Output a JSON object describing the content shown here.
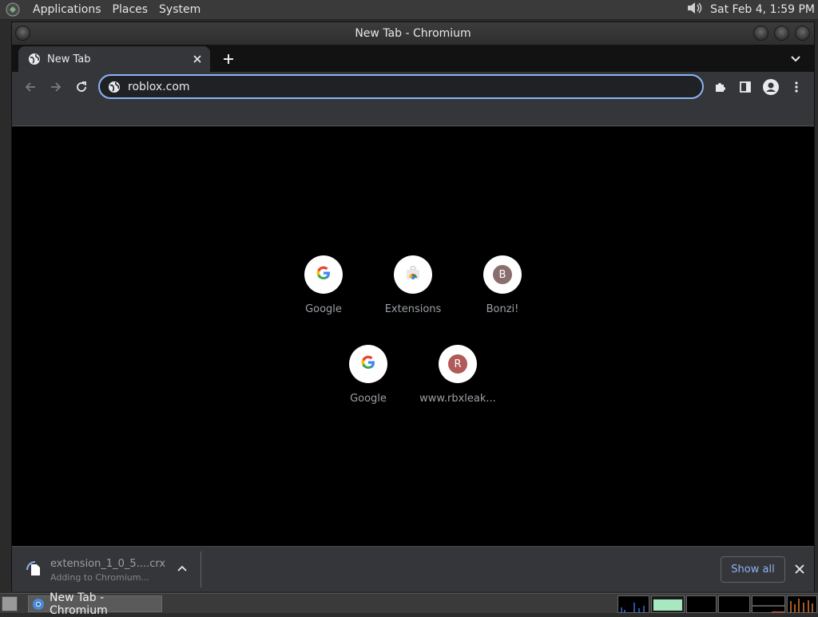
{
  "top_panel": {
    "menus": [
      "Applications",
      "Places",
      "System"
    ],
    "clock": "Sat Feb  4,  1:59 PM"
  },
  "window": {
    "title": "New Tab - Chromium"
  },
  "tab": {
    "title": "New Tab"
  },
  "omnibox": {
    "value": "roblox.com"
  },
  "shortcuts": [
    {
      "label": "Google",
      "icon": "google-g-icon"
    },
    {
      "label": "Extensions",
      "icon": "chrome-web-store-icon"
    },
    {
      "label": "Bonzi!",
      "letter": "B",
      "color": "#8a6d6d"
    },
    {
      "label": "Google",
      "icon": "google-g-icon"
    },
    {
      "label": "www.rbxleak...",
      "letter": "R",
      "color": "#b05a5a"
    }
  ],
  "download": {
    "filename": "extension_1_0_5....crx",
    "status": "Adding to Chromium..."
  },
  "download_shelf": {
    "show_all_label": "Show all"
  },
  "taskbar": {
    "task_label": "New Tab - Chromium"
  },
  "colors": {
    "accent": "#8ab4f8",
    "toolbar": "#35363a",
    "content_bg": "#000000"
  }
}
